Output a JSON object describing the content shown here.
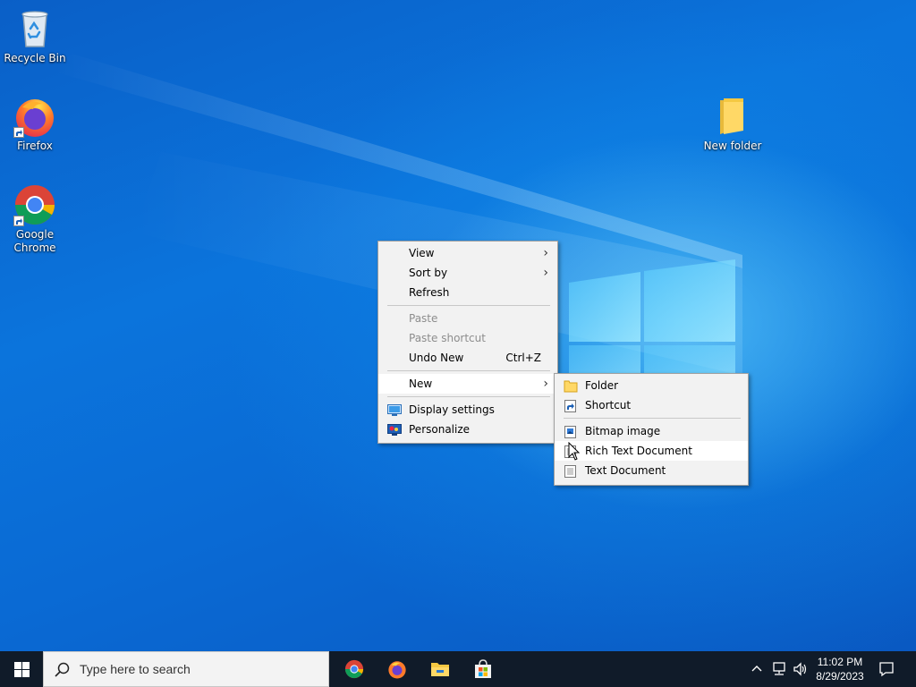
{
  "desktop": {
    "icons": [
      {
        "label": "Recycle Bin"
      },
      {
        "label": "Firefox"
      },
      {
        "label": "Google Chrome"
      },
      {
        "label": "New folder"
      }
    ]
  },
  "context_menu": {
    "items": {
      "view": "View",
      "sort_by": "Sort by",
      "refresh": "Refresh",
      "paste": "Paste",
      "paste_shortcut": "Paste shortcut",
      "undo_new": "Undo New",
      "undo_new_accel": "Ctrl+Z",
      "new": "New",
      "display_settings": "Display settings",
      "personalize": "Personalize"
    }
  },
  "new_submenu": {
    "items": {
      "folder": "Folder",
      "shortcut": "Shortcut",
      "bitmap": "Bitmap image",
      "rtf": "Rich Text Document",
      "text": "Text Document"
    },
    "hovered": "Rich Text Document"
  },
  "taskbar": {
    "search_placeholder": "Type here to search",
    "pinned_apps": [
      "chrome-icon",
      "firefox-icon",
      "file-explorer-icon",
      "microsoft-store-icon"
    ],
    "clock": {
      "time": "11:02 PM",
      "date": "8/29/2023"
    }
  },
  "colors": {
    "accent": "#0078d7",
    "taskbar": "#101b29",
    "menu_bg": "#f2f2f2"
  }
}
